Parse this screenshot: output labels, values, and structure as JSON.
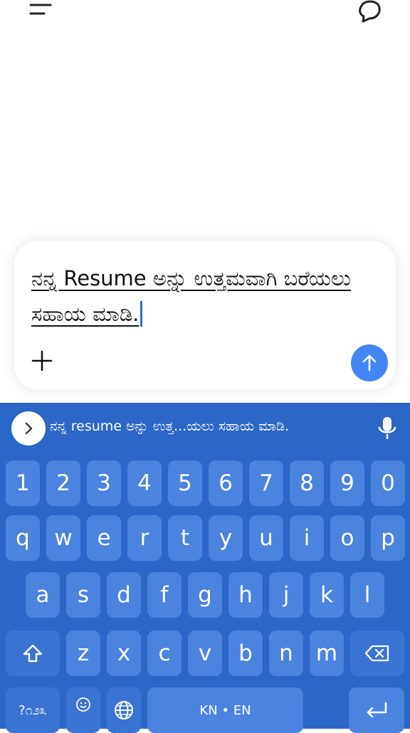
{
  "header": {
    "menu_icon": "menu-icon",
    "chat_icon": "new-chat-icon"
  },
  "composer": {
    "text": "ನನ್ನ Resume ಅನ್ನು ಉತ್ತಮವಾಗಿ ಬರೆಯಲು ಸಹಾಯ ಮಾಡಿ.",
    "add_icon": "plus-icon",
    "send_icon": "arrow-up-icon",
    "send_color": "#4286f5"
  },
  "keyboard": {
    "background": "#2a67c7",
    "key_color": "#4a84de",
    "suggestion": "ನನ್ನ resume ಅನ್ನು ಉತ್ತ...ಯಲು ಸಹಾಯ ಮಾಡಿ.",
    "number_row": [
      "1",
      "2",
      "3",
      "4",
      "5",
      "6",
      "7",
      "8",
      "9",
      "0"
    ],
    "row1": [
      "q",
      "w",
      "e",
      "r",
      "t",
      "y",
      "u",
      "i",
      "o",
      "p"
    ],
    "row2": [
      "a",
      "s",
      "d",
      "f",
      "g",
      "h",
      "j",
      "k",
      "l"
    ],
    "row3": [
      "z",
      "x",
      "c",
      "v",
      "b",
      "n",
      "m"
    ],
    "symbols_label": "?೧೨೩",
    "space_label": "KN • EN"
  }
}
